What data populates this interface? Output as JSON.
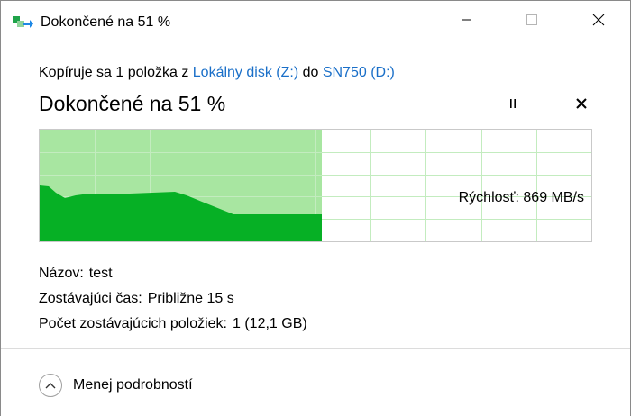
{
  "window": {
    "title": "Dokončené na 51 %",
    "icon": "file-copy-icon"
  },
  "caption_buttons": {
    "minimize_icon": "minimize-icon",
    "maximize_icon": "maximize-icon",
    "close_icon": "close-icon"
  },
  "copy": {
    "prefix": "Kopíruje sa 1 položka z",
    "source": "Lokálny disk (Z:)",
    "connector": "do",
    "destination": "SN750 (D:)",
    "heading": "Dokončené na 51 %",
    "progress_percent": 51
  },
  "controls": {
    "pause_icon": "pause-icon",
    "cancel_icon": "cancel-icon"
  },
  "graph": {
    "speed_label": "Rýchlosť: 869 MB/s",
    "colors": {
      "completed_fill": "#a8e6a1",
      "speed_fill": "#06b025",
      "grid": "#c3ecbf",
      "border": "#c9c9c9"
    }
  },
  "details": {
    "name_label": "Názov:",
    "name_value": "test",
    "time_label": "Zostávajúci čas:",
    "time_value": "Približne 15 s",
    "items_label": "Počet zostávajúcich položiek:",
    "items_value": "1 (12,1 GB)"
  },
  "footer": {
    "toggle_label": "Menej podrobností",
    "toggle_icon": "chevron-up-icon"
  }
}
